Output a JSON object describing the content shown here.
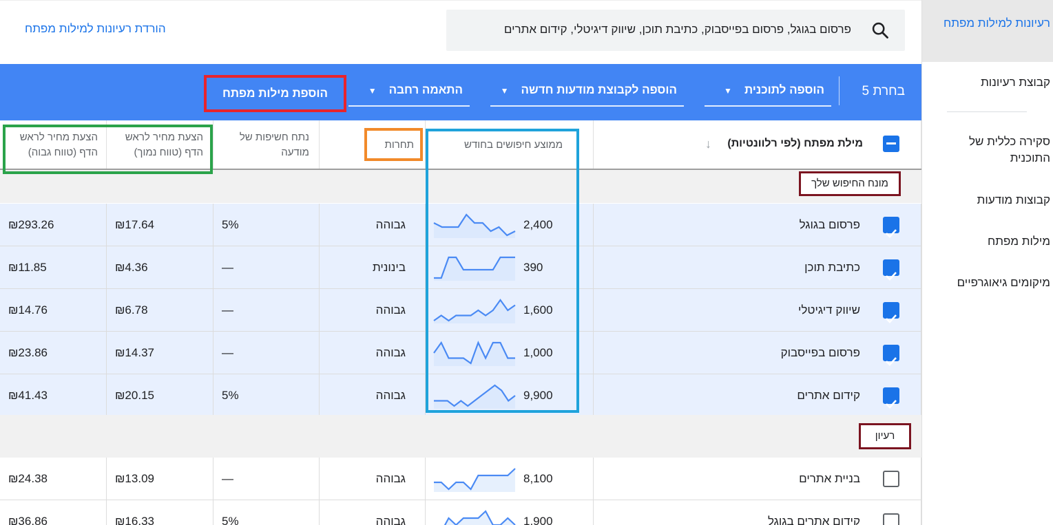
{
  "sidebar": {
    "items": [
      {
        "label": "רעיונות למילות מפתח",
        "active": true
      },
      {
        "label": "קבוצת רעיונות"
      },
      {
        "label": "סקירה כללית של התוכנית"
      },
      {
        "label": "קבוצות מודעות"
      },
      {
        "label": "מילות מפתח"
      },
      {
        "label": "מיקומים גיאוגרפיים"
      }
    ]
  },
  "top": {
    "download_label": "הורדת רעיונות למילות מפתח",
    "search_value": "פרסום בגוגל, פרסום בפייסבוק, כתיבת תוכן, שיווק דיגיטלי, קידום אתרים",
    "search_icon": "search-icon"
  },
  "toolbar": {
    "selected_label": "בחרת 5",
    "add_to_plan": "הוספה לתוכנית",
    "add_to_group": "הוספה לקבוצת מודעות חדשה",
    "match_type": "התאמה רחבה",
    "add_keywords": "הוספת מילות מפתח",
    "bar_color": "#4285f4"
  },
  "table": {
    "headers": {
      "keyword": "מילת מפתח (לפי רלוונטיות)",
      "searches": "ממוצע חיפושים בחודש",
      "competition": "תחרות",
      "impression_share": "נתח חשיפות של מודעה",
      "bid_low": "הצעת מחיר לראש הדף (טווח נמוך)",
      "bid_high": "הצעת מחיר לראש הדף (טווח גבוה)"
    },
    "sections": [
      {
        "label": "מונח החיפוש שלך",
        "rows": [
          {
            "keyword": "פרסום בגוגל",
            "searches": "2,400",
            "competition": "גבוהה",
            "share": "5%",
            "low": "₪17.64",
            "high": "₪293.26",
            "checked": true,
            "trend": [
              3,
              2,
              2,
              2,
              5,
              3,
              3,
              1,
              2,
              0,
              1
            ]
          },
          {
            "keyword": "כתיבת תוכן",
            "searches": "390",
            "competition": "בינונית",
            "share": "—",
            "low": "₪4.36",
            "high": "₪11.85",
            "checked": true,
            "trend": [
              0,
              0,
              5,
              5,
              2,
              2,
              2,
              2,
              2,
              5,
              5,
              5
            ]
          },
          {
            "keyword": "שיווק דיגיטלי",
            "searches": "1,600",
            "competition": "גבוהה",
            "share": "—",
            "low": "₪6.78",
            "high": "₪14.76",
            "checked": true,
            "trend": [
              0,
              1,
              0,
              1,
              1,
              1,
              2,
              1,
              2,
              4,
              2,
              3
            ]
          },
          {
            "keyword": "פרסום בפייסבוק",
            "searches": "1,000",
            "competition": "גבוהה",
            "share": "—",
            "low": "₪14.37",
            "high": "₪23.86",
            "checked": true,
            "trend": [
              3,
              5,
              2,
              2,
              2,
              1,
              5,
              2,
              5,
              5,
              2,
              2
            ]
          },
          {
            "keyword": "קידום אתרים",
            "searches": "9,900",
            "competition": "גבוהה",
            "share": "5%",
            "low": "₪20.15",
            "high": "₪41.43",
            "checked": true,
            "trend": [
              1,
              1,
              1,
              0,
              1,
              0,
              1,
              2,
              3,
              4,
              3,
              1,
              2
            ]
          }
        ]
      },
      {
        "label": "רעיון",
        "rows": [
          {
            "keyword": "בניית אתרים",
            "searches": "8,100",
            "competition": "גבוהה",
            "share": "—",
            "low": "₪13.09",
            "high": "₪24.38",
            "checked": false,
            "trend": [
              1,
              1,
              0,
              1,
              1,
              0,
              2,
              2,
              2,
              2,
              2,
              3
            ]
          },
          {
            "keyword": "קידום אתרים בגוגל",
            "searches": "1,900",
            "competition": "גבוהה",
            "share": "5%",
            "low": "₪16.33",
            "high": "₪36.86",
            "checked": false,
            "trend": [
              1,
              1,
              3,
              2,
              3,
              3,
              3,
              4,
              2,
              2,
              3,
              2
            ]
          }
        ]
      }
    ]
  },
  "colors": {
    "accent": "#1a73e8",
    "selected_row": "#e8f0fe",
    "highlight_red": "#e8242c",
    "highlight_green": "#2ba34a",
    "highlight_orange": "#f28a2a",
    "highlight_blue": "#1fa3db",
    "highlight_maroon": "#7b1420"
  }
}
